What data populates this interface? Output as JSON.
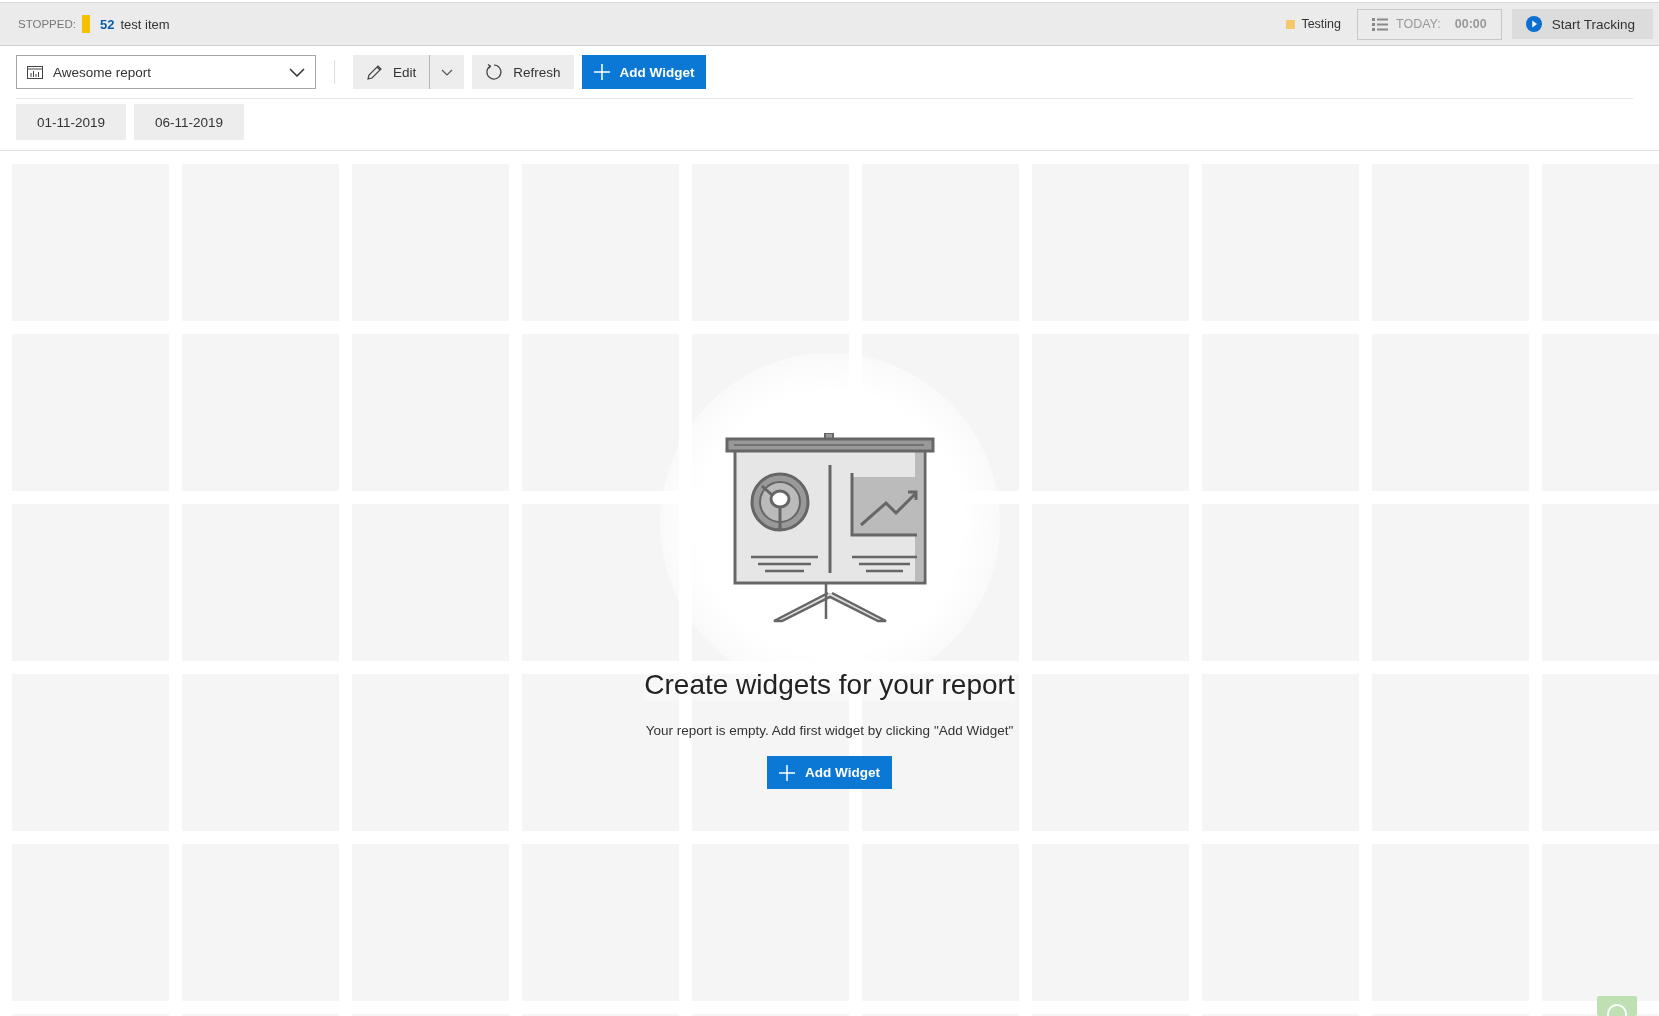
{
  "status_bar": {
    "state_label": "STOPPED:",
    "item": {
      "color": "#f2c200",
      "number": "52",
      "name": "test item"
    },
    "project": {
      "name": "Testing",
      "color": "#f5c96b"
    },
    "today_label": "TODAY:",
    "today_time": "00:00",
    "start_button": "Start Tracking"
  },
  "toolbar": {
    "report_select": "Awesome report",
    "edit_button": "Edit",
    "refresh_button": "Refresh",
    "add_widget_button": "Add Widget"
  },
  "date_range": [
    "01-11-2019",
    "06-11-2019"
  ],
  "empty_state": {
    "title": "Create widgets for your report",
    "message": "Your report is empty. Add first widget by clicking \"Add Widget\"",
    "button": "Add Widget"
  }
}
